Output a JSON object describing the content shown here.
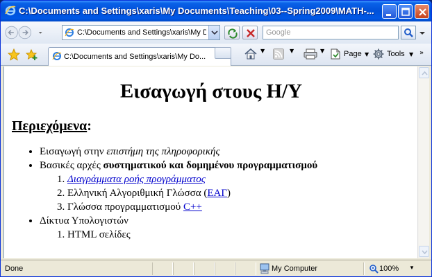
{
  "window": {
    "title": "C:\\Documents and Settings\\xaris\\My Documents\\Teaching\\03--Spring2009\\MATH-..."
  },
  "toolbar": {
    "address": "C:\\Documents and Settings\\xaris\\My Do",
    "search_placeholder": "Google"
  },
  "tabs": [
    {
      "label": "C:\\Documents and Settings\\xaris\\My Do..."
    }
  ],
  "commands": {
    "page": "Page",
    "tools": "Tools",
    "more": "»"
  },
  "page": {
    "title": "Εισαγωγή στους Η/Υ",
    "contents_heading": "Περιεχόμενα",
    "contents_colon": ":",
    "items": [
      {
        "prefix": "Εισαγωγή στην ",
        "emphasis": "επιστήμη της πληροφορικής"
      },
      {
        "prefix": "Βασικές αρχές ",
        "bold": "συστηματικού και δομημένου προγραμματισμού",
        "subitems": [
          {
            "link": "Διαγράμματα ροής προγράμματος"
          },
          {
            "prefix": "Ελληνική Αλγοριθμική Γλώσσα (",
            "link": "ΕΑΓ",
            "suffix": ")"
          },
          {
            "prefix": "Γλώσσα προγραμματισμού ",
            "link": "C++"
          }
        ]
      },
      {
        "text": "Δίκτυα Υπολογιστών",
        "subitems": [
          {
            "text": "HTML σελίδες"
          }
        ]
      }
    ]
  },
  "status": {
    "text": "Done",
    "zone": "My Computer",
    "zoom": "100%"
  },
  "colors": {
    "titlebar": "#0054e3",
    "link": "#0000cc"
  }
}
